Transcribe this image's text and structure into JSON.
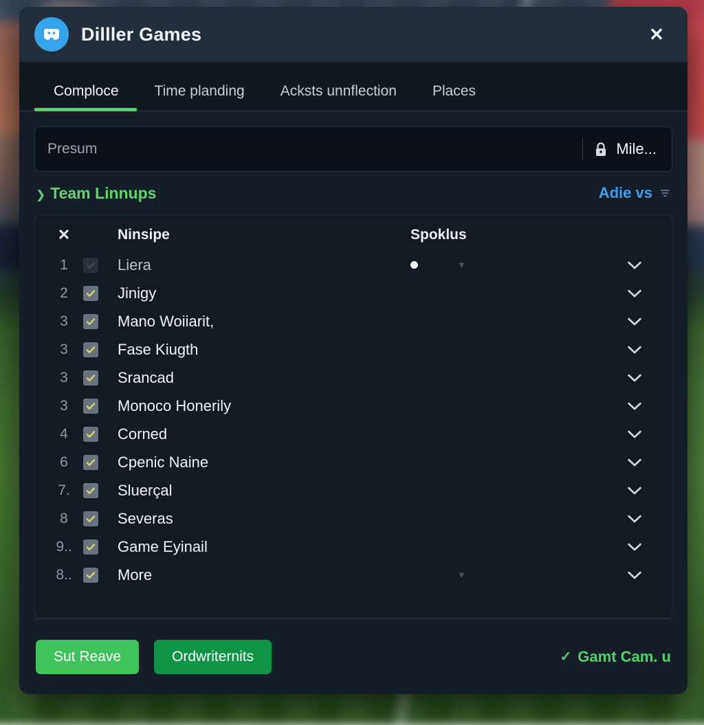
{
  "window": {
    "title": "Dilller Games",
    "logo_icon": "game-controller-avatar-icon",
    "close_icon": "close-icon"
  },
  "tabs": [
    {
      "label": "Comploce",
      "active": true
    },
    {
      "label": "Time planding",
      "active": false
    },
    {
      "label": "Acksts unnflection",
      "active": false
    },
    {
      "label": "Places",
      "active": false
    }
  ],
  "search": {
    "placeholder": "Presum",
    "value": "",
    "lock_icon": "lock-icon",
    "right_label": "Mile..."
  },
  "section": {
    "chevron_icon": "chevron-right-icon",
    "title": "Team Linnups",
    "link": "Adie vs",
    "sort_icon": "sort-icon"
  },
  "table": {
    "head": {
      "x_icon": "x-icon",
      "name_col": "Ninsipe",
      "stat_col": "Spoklus"
    },
    "rows": [
      {
        "num": "1",
        "checked": false,
        "name": "Liera",
        "stat_dot": true,
        "stat_caret": true,
        "chevron_icon": "chevron-down-icon"
      },
      {
        "num": "2",
        "checked": true,
        "name": "Jinigy",
        "stat_dot": false,
        "stat_caret": false,
        "chevron_icon": "chevron-down-icon"
      },
      {
        "num": "3",
        "checked": true,
        "name": "Mano Woiiarit,",
        "stat_dot": false,
        "stat_caret": false,
        "chevron_icon": "chevron-down-icon"
      },
      {
        "num": "3",
        "checked": true,
        "name": "Fase Kiugth",
        "stat_dot": false,
        "stat_caret": false,
        "chevron_icon": "chevron-down-icon"
      },
      {
        "num": "3",
        "checked": true,
        "name": "Srancad",
        "stat_dot": false,
        "stat_caret": false,
        "chevron_icon": "chevron-down-icon"
      },
      {
        "num": "3",
        "checked": true,
        "name": "Monoco Honerily",
        "stat_dot": false,
        "stat_caret": false,
        "chevron_icon": "chevron-down-icon"
      },
      {
        "num": "4",
        "checked": true,
        "name": "Corned",
        "stat_dot": false,
        "stat_caret": false,
        "chevron_icon": "chevron-down-icon"
      },
      {
        "num": "6",
        "checked": true,
        "name": "Cpenic Naine",
        "stat_dot": false,
        "stat_caret": false,
        "chevron_icon": "chevron-down-icon"
      },
      {
        "num": "7.",
        "checked": true,
        "name": "Sluerçal",
        "stat_dot": false,
        "stat_caret": false,
        "chevron_icon": "chevron-down-icon"
      },
      {
        "num": "8",
        "checked": true,
        "name": "Severas",
        "stat_dot": false,
        "stat_caret": false,
        "chevron_icon": "chevron-down-icon"
      },
      {
        "num": "9..",
        "checked": true,
        "name": "Game Eyinail",
        "stat_dot": false,
        "stat_caret": false,
        "chevron_icon": "chevron-down-icon"
      },
      {
        "num": "8..",
        "checked": true,
        "name": "More",
        "stat_dot": false,
        "stat_caret": true,
        "chevron_icon": "chevron-down-icon"
      }
    ]
  },
  "footer": {
    "primary_label": "Sut Reave",
    "secondary_label": "Ordwriternits",
    "status_icon": "check-icon",
    "status_label": "Gamt Cam. u"
  },
  "colors": {
    "accent_green": "#52d26a",
    "link_blue": "#3c9cf0",
    "logo_blue": "#36a4e8",
    "primary_button": "#3fc35a",
    "secondary_button": "#109447",
    "modal_bg": "#151e28",
    "header_bg": "#222e3c"
  }
}
